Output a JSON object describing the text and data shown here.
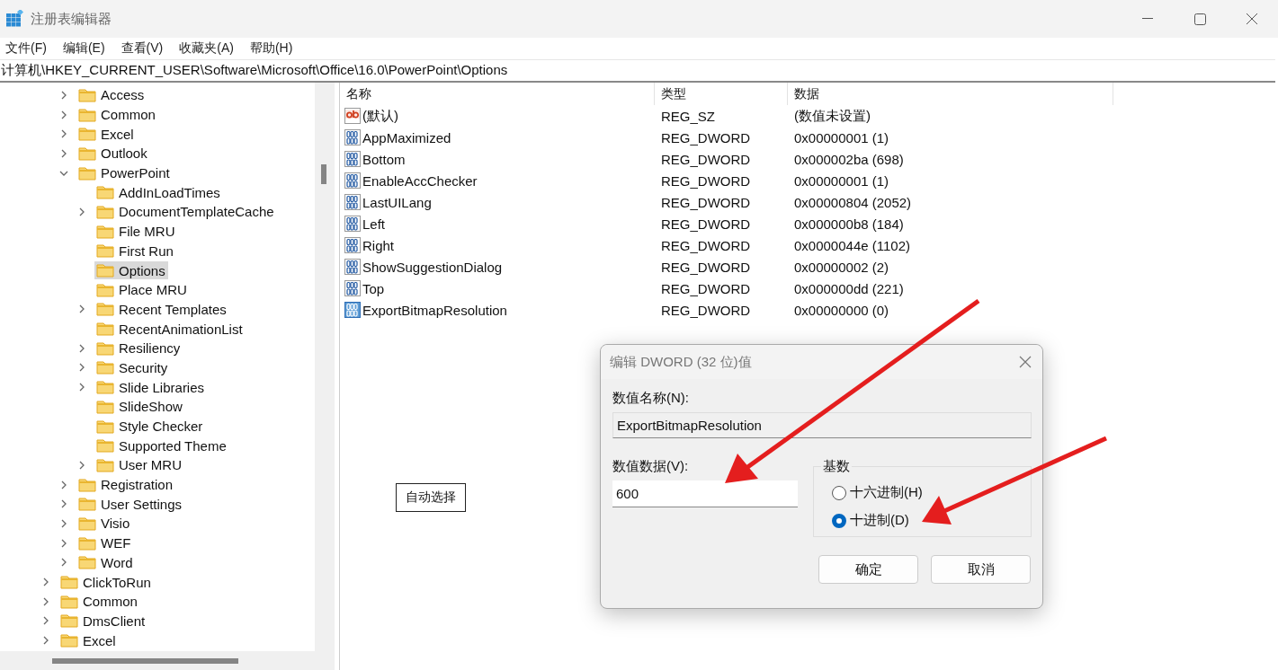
{
  "window": {
    "title": "注册表编辑器"
  },
  "menu": [
    "文件(F)",
    "编辑(E)",
    "查看(V)",
    "收藏夹(A)",
    "帮助(H)"
  ],
  "address": "计算机\\HKEY_CURRENT_USER\\Software\\Microsoft\\Office\\16.0\\PowerPoint\\Options",
  "tree": {
    "subkeys": [
      {
        "label": "Access",
        "expanded": false,
        "selected": false
      },
      {
        "label": "Common",
        "expanded": false,
        "selected": false
      },
      {
        "label": "Excel",
        "expanded": false,
        "selected": false
      },
      {
        "label": "Outlook",
        "expanded": false,
        "selected": false
      },
      {
        "label": "PowerPoint",
        "expanded": true,
        "selected": false,
        "children": [
          {
            "label": "AddInLoadTimes",
            "selected": false
          },
          {
            "label": "DocumentTemplateCache",
            "expanded": false,
            "selected": false
          },
          {
            "label": "File MRU",
            "selected": false
          },
          {
            "label": "First Run",
            "selected": false
          },
          {
            "label": "Options",
            "selected": true
          },
          {
            "label": "Place MRU",
            "selected": false
          },
          {
            "label": "Recent Templates",
            "expanded": false,
            "selected": false
          },
          {
            "label": "RecentAnimationList",
            "selected": false
          },
          {
            "label": "Resiliency",
            "expanded": false,
            "selected": false
          },
          {
            "label": "Security",
            "expanded": false,
            "selected": false
          },
          {
            "label": "Slide Libraries",
            "expanded": false,
            "selected": false
          },
          {
            "label": "SlideShow",
            "selected": false
          },
          {
            "label": "Style Checker",
            "selected": false
          },
          {
            "label": "Supported Theme",
            "selected": false
          },
          {
            "label": "User MRU",
            "expanded": false,
            "selected": false
          }
        ]
      },
      {
        "label": "Registration",
        "expanded": false,
        "selected": false
      },
      {
        "label": "User Settings",
        "expanded": false,
        "selected": false
      },
      {
        "label": "Visio",
        "expanded": false,
        "selected": false
      },
      {
        "label": "WEF",
        "expanded": false,
        "selected": false
      },
      {
        "label": "Word",
        "expanded": false,
        "selected": false
      }
    ],
    "outer_keys": [
      {
        "label": "ClickToRun",
        "expanded": false,
        "selected": false
      },
      {
        "label": "Common",
        "expanded": false,
        "selected": false
      },
      {
        "label": "DmsClient",
        "expanded": false,
        "selected": false
      },
      {
        "label": "Excel",
        "expanded": false,
        "selected": false
      }
    ]
  },
  "table": {
    "columns": [
      "名称",
      "类型",
      "数据"
    ],
    "rows": [
      {
        "kind": "string",
        "name": "(默认)",
        "type": "REG_SZ",
        "data": "(数值未设置)",
        "selected": false
      },
      {
        "kind": "dword",
        "name": "AppMaximized",
        "type": "REG_DWORD",
        "data": "0x00000001 (1)",
        "selected": false
      },
      {
        "kind": "dword",
        "name": "Bottom",
        "type": "REG_DWORD",
        "data": "0x000002ba (698)",
        "selected": false
      },
      {
        "kind": "dword",
        "name": "EnableAccChecker",
        "type": "REG_DWORD",
        "data": "0x00000001 (1)",
        "selected": false
      },
      {
        "kind": "dword",
        "name": "LastUILang",
        "type": "REG_DWORD",
        "data": "0x00000804 (2052)",
        "selected": false
      },
      {
        "kind": "dword",
        "name": "Left",
        "type": "REG_DWORD",
        "data": "0x000000b8 (184)",
        "selected": false
      },
      {
        "kind": "dword",
        "name": "Right",
        "type": "REG_DWORD",
        "data": "0x0000044e (1102)",
        "selected": false
      },
      {
        "kind": "dword",
        "name": "ShowSuggestionDialog",
        "type": "REG_DWORD",
        "data": "0x00000002 (2)",
        "selected": false
      },
      {
        "kind": "dword",
        "name": "Top",
        "type": "REG_DWORD",
        "data": "0x000000dd (221)",
        "selected": false
      },
      {
        "kind": "dword",
        "name": "ExportBitmapResolution",
        "type": "REG_DWORD",
        "data": "0x00000000 (0)",
        "selected": true
      }
    ]
  },
  "tooltip": {
    "text": "自动选择"
  },
  "dialog": {
    "title": "编辑 DWORD (32 位)值",
    "name_label": "数值名称(N):",
    "name_value": "ExportBitmapResolution",
    "data_label": "数值数据(V):",
    "data_value": "600",
    "base_label": "基数",
    "base_options": [
      {
        "label": "十六进制(H)",
        "selected": false
      },
      {
        "label": "十进制(D)",
        "selected": true
      }
    ],
    "buttons": [
      "确定",
      "取消"
    ]
  }
}
